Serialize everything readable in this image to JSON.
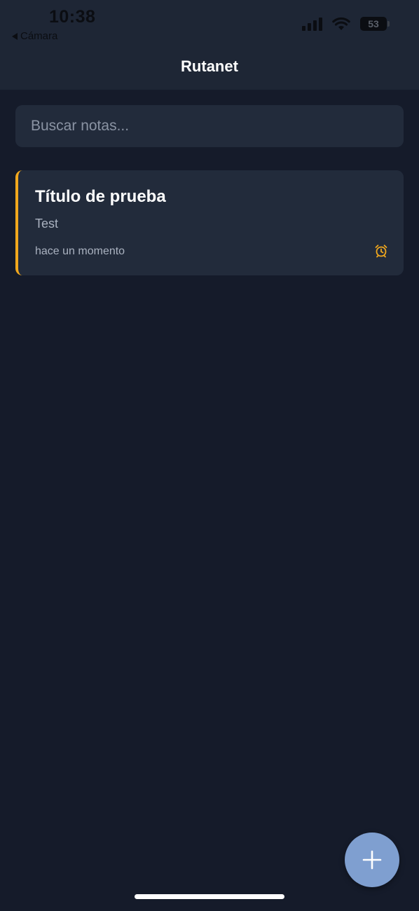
{
  "status_bar": {
    "time": "10:38",
    "back_label": "Cámara",
    "battery": "53"
  },
  "header": {
    "title": "Rutanet"
  },
  "search": {
    "placeholder": "Buscar notas...",
    "value": ""
  },
  "notes": [
    {
      "title": "Título de prueba",
      "body": "Test",
      "time": "hace un momento",
      "icon": "alarm-icon"
    }
  ],
  "fab": {
    "icon": "plus-icon"
  },
  "colors": {
    "background": "#151b2a",
    "surface": "#222b3b",
    "accent": "#f2a81d",
    "fab": "#7f9fd0"
  }
}
